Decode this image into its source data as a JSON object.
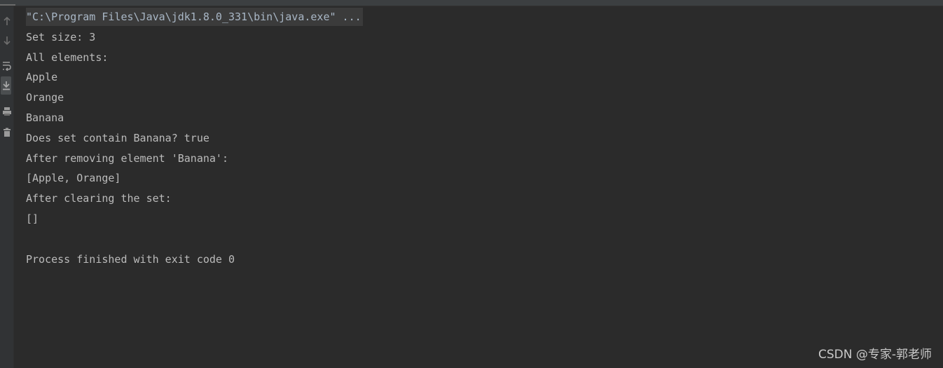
{
  "console": {
    "command": "\"C:\\Program Files\\Java\\jdk1.8.0_331\\bin\\java.exe\" ...",
    "output_lines": [
      "Set size: 3",
      "All elements:",
      "Apple",
      "Orange",
      "Banana",
      "Does set contain Banana? true",
      "After removing element 'Banana':",
      "[Apple, Orange]",
      "After clearing the set:",
      "[]",
      "",
      "Process finished with exit code 0"
    ]
  },
  "gutter": {
    "icons": [
      "arrow-up-icon",
      "arrow-down-icon",
      "soft-wrap-icon",
      "scroll-to-end-icon",
      "print-icon",
      "trash-icon"
    ]
  },
  "watermark": {
    "text": "CSDN @专家-郭老师"
  },
  "colors": {
    "background": "#2b2b2b",
    "gutter": "#313335",
    "text": "#bbbbbb",
    "command_highlight": "#3b3b3b"
  }
}
